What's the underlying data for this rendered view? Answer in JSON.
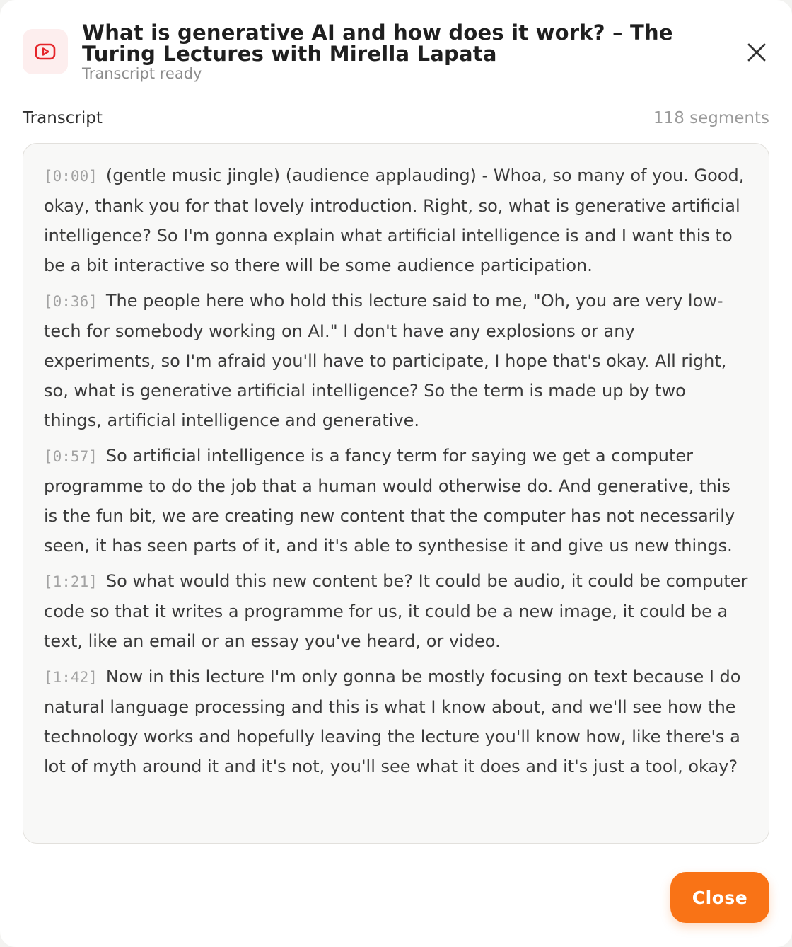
{
  "header": {
    "icon": "youtube-play-icon",
    "title": "What is generative AI and how does it work? – The Turing Lectures with Mirella Lapata",
    "status": "Transcript ready"
  },
  "section": {
    "label": "Transcript",
    "count": "118 segments"
  },
  "segments": [
    {
      "time": "[0:00]",
      "text": "(gentle music jingle) (audience applauding) - Whoa, so many of you. Good, okay, thank you for that lovely introduction. Right, so, what is generative artificial intelligence? So I'm gonna explain what artificial intelligence is and I want this to be a bit interactive so there will be some audience participation."
    },
    {
      "time": "[0:36]",
      "text": "The people here who hold this lecture said to me, \"Oh, you are very low-tech for somebody working on AI.\" I don't have any explosions or any experiments, so I'm afraid you'll have to participate, I hope that's okay. All right, so, what is generative artificial intelligence? So the term is made up by two things, artificial intelligence and generative."
    },
    {
      "time": "[0:57]",
      "text": "So artificial intelligence is a fancy term for saying we get a computer programme to do the job that a human would otherwise do. And generative, this is the fun bit, we are creating new content that the computer has not necessarily seen, it has seen parts of it, and it's able to synthesise it and give us new things."
    },
    {
      "time": "[1:21]",
      "text": "So what would this new content be? It could be audio, it could be computer code so that it writes a programme for us, it could be a new image, it could be a text, like an email or an essay you've heard, or video."
    },
    {
      "time": "[1:42]",
      "text": "Now in this lecture I'm only gonna be mostly focusing on text because I do natural language processing and this is what I know about, and we'll see how the technology works and hopefully leaving the lecture you'll know how, like there's a lot of myth around it and it's not, you'll see what it does and it's just a tool, okay?"
    }
  ],
  "footer": {
    "close_label": "Close"
  },
  "colors": {
    "accent": "#f97316",
    "icon_red": "#e5252a",
    "icon_bg": "#fdeeee"
  }
}
